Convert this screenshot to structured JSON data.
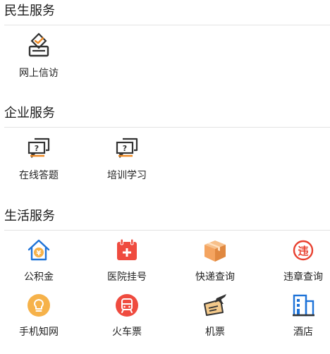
{
  "sections": [
    {
      "title": "民生服务",
      "items": [
        {
          "label": "网上信访",
          "icon": "vote-box-icon"
        }
      ]
    },
    {
      "title": "企业服务",
      "items": [
        {
          "label": "在线答题",
          "icon": "question-chat-icon"
        },
        {
          "label": "培训学习",
          "icon": "question-chat-icon"
        }
      ]
    },
    {
      "title": "生活服务",
      "items": [
        {
          "label": "公积金",
          "icon": "house-fund-icon"
        },
        {
          "label": "医院挂号",
          "icon": "calendar-plus-icon"
        },
        {
          "label": "快递查询",
          "icon": "parcel-box-icon"
        },
        {
          "label": "违章查询",
          "icon": "violation-stamp-icon"
        },
        {
          "label": "手机知网",
          "icon": "lightbulb-icon"
        },
        {
          "label": "火车票",
          "icon": "train-icon"
        },
        {
          "label": "机票",
          "icon": "plane-ticket-icon"
        },
        {
          "label": "酒店",
          "icon": "hotel-building-icon"
        }
      ]
    }
  ],
  "icon_texts": {
    "question_mark": "?",
    "yuan_sign": "¥",
    "violation_char": "违"
  },
  "colors": {
    "blue": "#1e73d8",
    "red": "#ef4b3f",
    "orange_box": "#f4a460",
    "yellow": "#f6b24a",
    "dark": "#333333"
  }
}
